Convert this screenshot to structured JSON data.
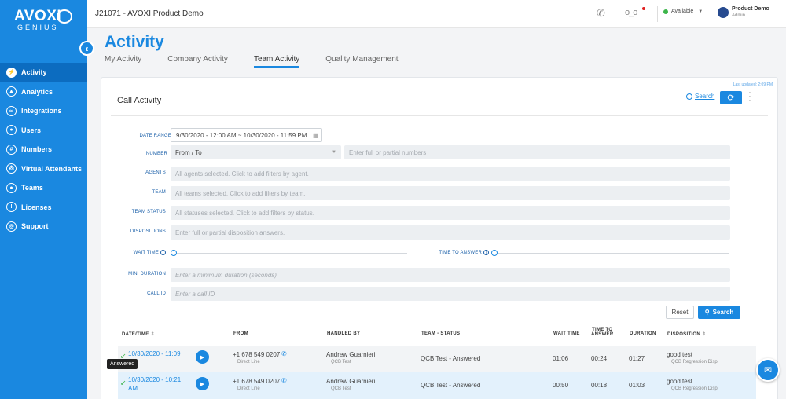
{
  "brand": {
    "name": "AVOXI",
    "sub": "GENIUS"
  },
  "nav": [
    {
      "label": "Activity",
      "icon": "bolt-icon",
      "glyph": "⚡",
      "active": true
    },
    {
      "label": "Analytics",
      "icon": "chart-icon",
      "glyph": "▲"
    },
    {
      "label": "Integrations",
      "icon": "link-icon",
      "glyph": "∞"
    },
    {
      "label": "Users",
      "icon": "user-icon",
      "glyph": "●"
    },
    {
      "label": "Numbers",
      "icon": "hash-icon",
      "glyph": "#"
    },
    {
      "label": "Virtual Attendants",
      "icon": "network-icon",
      "glyph": "⁂"
    },
    {
      "label": "Teams",
      "icon": "team-icon",
      "glyph": "●"
    },
    {
      "label": "Licenses",
      "icon": "license-icon",
      "glyph": "!"
    },
    {
      "label": "Support",
      "icon": "support-icon",
      "glyph": "◎"
    }
  ],
  "topbar": {
    "title": "J21071 - AVOXI Product Demo",
    "status": "Available",
    "user_name": "Product Demo",
    "user_role": "Admin"
  },
  "page": {
    "title": "Activity",
    "tabs": [
      "My Activity",
      "Company Activity",
      "Team Activity",
      "Quality Management"
    ],
    "active_tab": "Team Activity"
  },
  "panel": {
    "last_updated": "Last updated: 2:09 PM",
    "title": "Call Activity",
    "search_link": "Search"
  },
  "filters": {
    "date_range_label": "DATE RANGE",
    "date_range_value": "9/30/2020 - 12:00 AM ~ 10/30/2020 - 11:59 PM",
    "number_label": "NUMBER",
    "number_select": "From / To",
    "number_placeholder": "Enter full or partial numbers",
    "agents_label": "AGENTS",
    "agents_placeholder": "All agents selected. Click to add filters by agent.",
    "team_label": "TEAM",
    "team_placeholder": "All teams selected. Click to add filters by team.",
    "team_status_label": "TEAM STATUS",
    "team_status_placeholder": "All statuses selected. Click to add filters by status.",
    "dispositions_label": "DISPOSITIONS",
    "dispositions_placeholder": "Enter full or partial disposition answers.",
    "wait_time_label": "WAIT TIME",
    "time_to_answer_label": "TIME TO ANSWER",
    "min_duration_label": "MIN. DURATION",
    "min_duration_placeholder": "Enter a minimum duration (seconds)",
    "call_id_label": "CALL ID",
    "call_id_placeholder": "Enter a call ID",
    "reset_label": "Reset",
    "search_label": "Search"
  },
  "table": {
    "headers": {
      "datetime": "DATE/TIME",
      "from": "FROM",
      "handled_by": "HANDLED BY",
      "team_status": "TEAM - STATUS",
      "wait_time": "WAIT TIME",
      "tta_1": "TIME TO",
      "tta_2": "ANSWER",
      "duration": "DURATION",
      "disposition": "DISPOSITION"
    },
    "rows": [
      {
        "datetime_1": "10/30/2020 - 11:09",
        "datetime_2": "",
        "from": "+1 678 549 0207",
        "from_sub": "Direct Line",
        "agent": "Andrew Guarnieri",
        "agent_sub": "QCB Test",
        "team_status": "QCB Test - Answered",
        "wait": "01:06",
        "tta": "00:24",
        "duration": "01:27",
        "disposition": "good test",
        "disposition_sub": "QCB Regression Disp"
      },
      {
        "datetime_1": "10/30/2020 - 10:21",
        "datetime_2": "AM",
        "from": "+1 678 549 0207",
        "from_sub": "Direct Line",
        "agent": "Andrew Guarnieri",
        "agent_sub": "QCB Test",
        "team_status": "QCB Test - Answered",
        "wait": "00:50",
        "tta": "00:18",
        "duration": "01:03",
        "disposition": "good test",
        "disposition_sub": "QCB Regression Disp"
      }
    ]
  },
  "tooltip": "Answered",
  "colors": {
    "primary": "#1a88e0",
    "sidebar_active": "#0c6cc0",
    "status_green": "#3cb54a"
  }
}
